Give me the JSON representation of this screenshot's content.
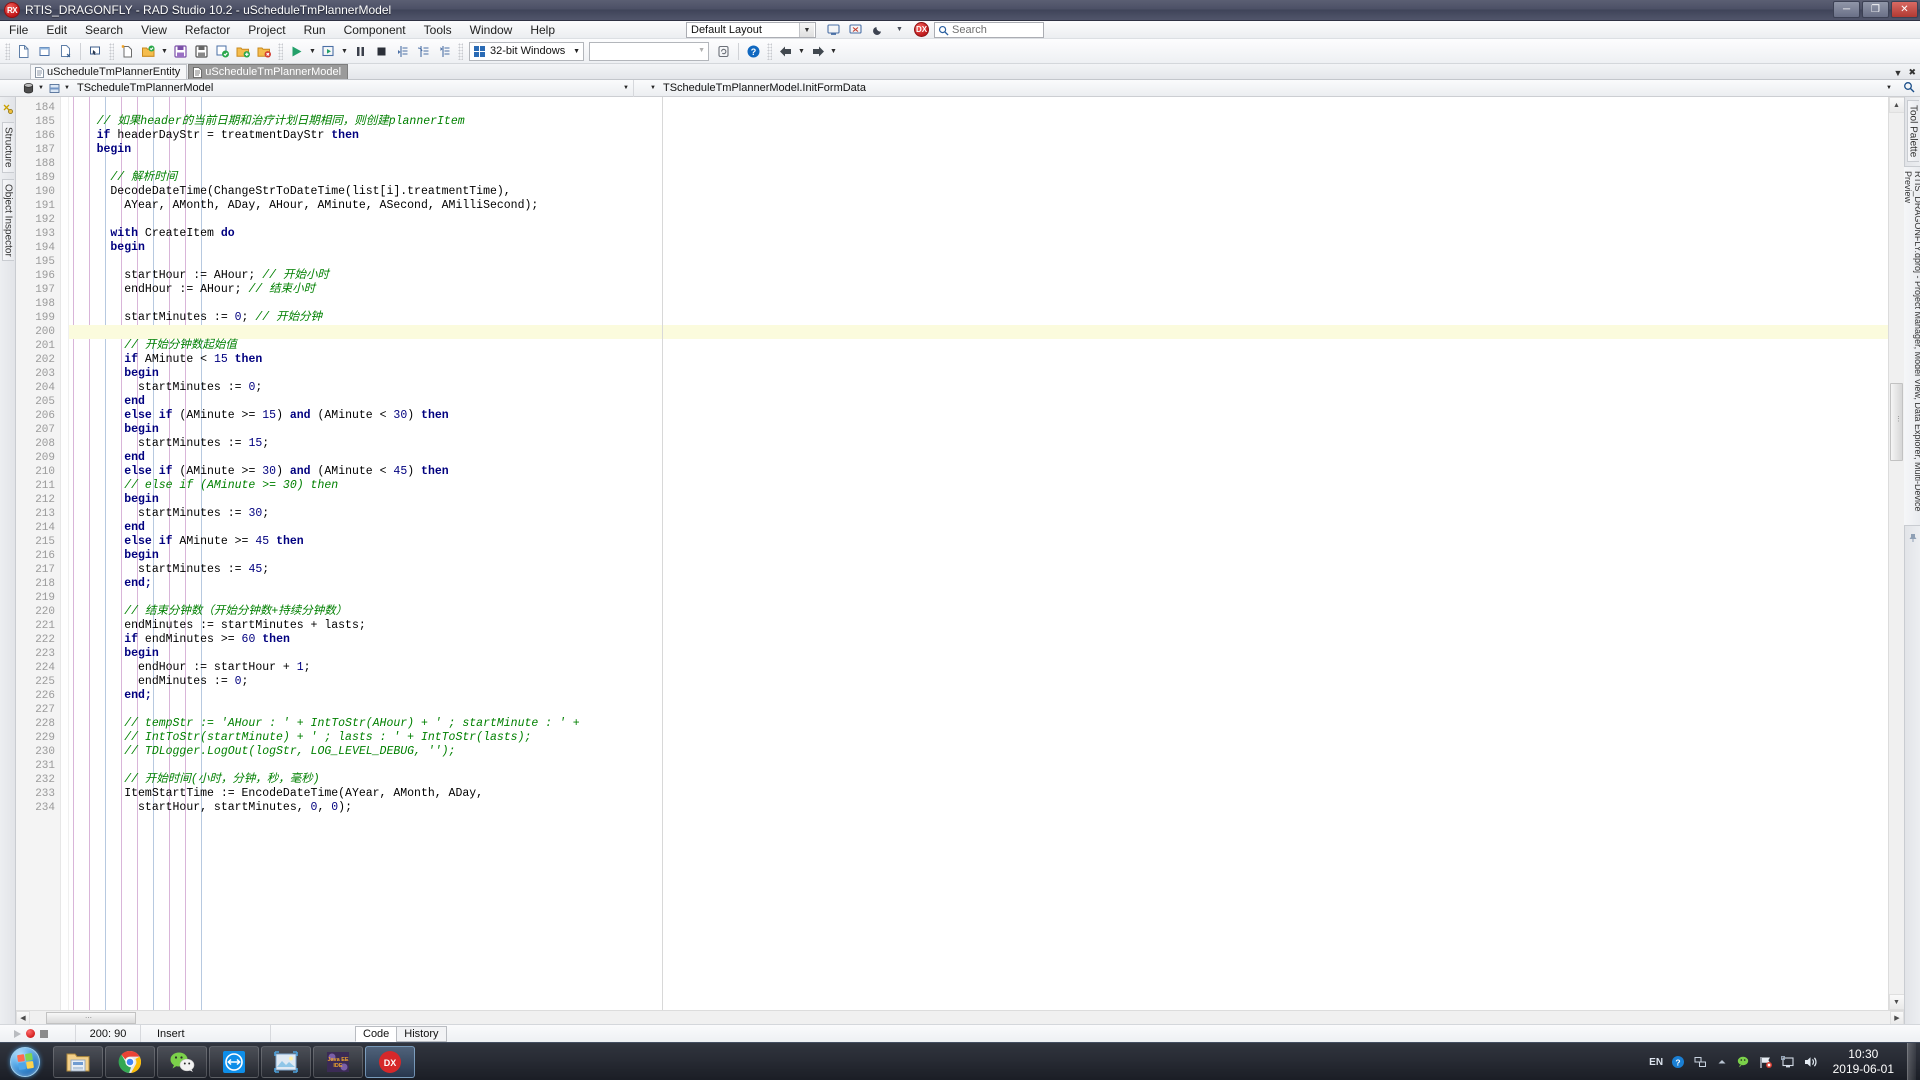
{
  "window": {
    "app_icon": "rad-studio-icon",
    "title": "RTIS_DRAGONFLY - RAD Studio 10.2 - uScheduleTmPlannerModel",
    "minimize": "─",
    "maximize": "❐",
    "close": "✕"
  },
  "menubar": {
    "items": [
      {
        "label": "File"
      },
      {
        "label": "Edit"
      },
      {
        "label": "Search"
      },
      {
        "label": "View"
      },
      {
        "label": "Refactor"
      },
      {
        "label": "Project"
      },
      {
        "label": "Run"
      },
      {
        "label": "Component"
      },
      {
        "label": "Tools"
      },
      {
        "label": "Window"
      },
      {
        "label": "Help"
      }
    ],
    "layout_combo": {
      "value": "Default Layout"
    },
    "search": {
      "placeholder": "Search",
      "value": ""
    }
  },
  "toolbar": {
    "platform_combo": {
      "value": "32-bit Windows"
    },
    "config_combo": {
      "value": ""
    },
    "buttons": [
      {
        "name": "new-file"
      },
      {
        "name": "new-form"
      },
      {
        "name": "new-other"
      },
      {
        "name": "view-form"
      },
      {
        "name": "open-file"
      },
      {
        "name": "open-project"
      },
      {
        "name": "save"
      },
      {
        "name": "save-as"
      },
      {
        "name": "save-all"
      },
      {
        "name": "add-to-project"
      },
      {
        "name": "remove-from-project"
      },
      {
        "name": "run"
      },
      {
        "name": "run-without-debugging"
      },
      {
        "name": "pause"
      },
      {
        "name": "stop"
      },
      {
        "name": "trace-into"
      },
      {
        "name": "step-over"
      },
      {
        "name": "run-to-cursor"
      },
      {
        "name": "refresh-config"
      },
      {
        "name": "help"
      },
      {
        "name": "back"
      },
      {
        "name": "forward"
      }
    ]
  },
  "file_tabs": [
    {
      "label": "uScheduleTmPlannerEntity",
      "active": false
    },
    {
      "label": "uScheduleTmPlannerModel",
      "active": true
    }
  ],
  "class_nav": {
    "left_value": "TScheduleTmPlannerModel",
    "right_value": "TScheduleTmPlannerModel.InitFormData"
  },
  "left_dock": {
    "tabs": [
      "Structure",
      "Object Inspector"
    ]
  },
  "right_dock": {
    "tabs": [
      "Tool Palette",
      "Project Manager, Model View, Data Explorer, Multi-Device Preview",
      "RTIS_DRAGONFLY.dproj - Project Manager, Model View, Data Explorer, Multi-Device Preview"
    ]
  },
  "editor": {
    "first_line": 184,
    "highlight_line": 200,
    "lines": [
      {
        "n": 184,
        "code": ""
      },
      {
        "n": 185,
        "code": "    // 如果header的当前日期和治疗计划日期相同，则创建plannerItem",
        "type": "comment"
      },
      {
        "n": 186,
        "code": "    if headerDayStr = treatmentDayStr then"
      },
      {
        "n": 187,
        "code": "    begin"
      },
      {
        "n": 188,
        "code": ""
      },
      {
        "n": 189,
        "code": "      // 解析时间",
        "type": "comment"
      },
      {
        "n": 190,
        "code": "      DecodeDateTime(ChangeStrToDateTime(list[i].treatmentTime),"
      },
      {
        "n": 191,
        "code": "        AYear, AMonth, ADay, AHour, AMinute, ASecond, AMilliSecond);"
      },
      {
        "n": 192,
        "code": ""
      },
      {
        "n": 193,
        "code": "      with CreateItem do"
      },
      {
        "n": 194,
        "code": "      begin"
      },
      {
        "n": 195,
        "code": ""
      },
      {
        "n": 196,
        "code": "        startHour := AHour; // 开始小时"
      },
      {
        "n": 197,
        "code": "        endHour := AHour; // 结束小时"
      },
      {
        "n": 198,
        "code": ""
      },
      {
        "n": 199,
        "code": "        startMinutes := 0; // 开始分钟"
      },
      {
        "n": 200,
        "code": "",
        "highlight": true
      },
      {
        "n": 201,
        "code": "        // 开始分钟数起始值",
        "type": "comment"
      },
      {
        "n": 202,
        "code": "        if AMinute < 15 then"
      },
      {
        "n": 203,
        "code": "        begin"
      },
      {
        "n": 204,
        "code": "          startMinutes := 0;"
      },
      {
        "n": 205,
        "code": "        end"
      },
      {
        "n": 206,
        "code": "        else if (AMinute >= 15) and (AMinute < 30) then"
      },
      {
        "n": 207,
        "code": "        begin"
      },
      {
        "n": 208,
        "code": "          startMinutes := 15;"
      },
      {
        "n": 209,
        "code": "        end"
      },
      {
        "n": 210,
        "code": "        else if (AMinute >= 30) and (AMinute < 45) then"
      },
      {
        "n": 211,
        "code": "        // else if (AMinute >= 30) then",
        "type": "comment"
      },
      {
        "n": 212,
        "code": "        begin"
      },
      {
        "n": 213,
        "code": "          startMinutes := 30;"
      },
      {
        "n": 214,
        "code": "        end"
      },
      {
        "n": 215,
        "code": "        else if AMinute >= 45 then"
      },
      {
        "n": 216,
        "code": "        begin"
      },
      {
        "n": 217,
        "code": "          startMinutes := 45;"
      },
      {
        "n": 218,
        "code": "        end;"
      },
      {
        "n": 219,
        "code": ""
      },
      {
        "n": 220,
        "code": "        // 结束分钟数（开始分钟数+持续分钟数）",
        "type": "comment"
      },
      {
        "n": 221,
        "code": "        endMinutes := startMinutes + lasts;"
      },
      {
        "n": 222,
        "code": "        if endMinutes >= 60 then"
      },
      {
        "n": 223,
        "code": "        begin"
      },
      {
        "n": 224,
        "code": "          endHour := startHour + 1;"
      },
      {
        "n": 225,
        "code": "          endMinutes := 0;"
      },
      {
        "n": 226,
        "code": "        end;"
      },
      {
        "n": 227,
        "code": ""
      },
      {
        "n": 228,
        "code": "        // tempStr := 'AHour : ' + IntToStr(AHour) + ' ; startMinute : ' +",
        "type": "comment"
      },
      {
        "n": 229,
        "code": "        // IntToStr(startMinute) + ' ; lasts : ' + IntToStr(lasts);",
        "type": "comment"
      },
      {
        "n": 230,
        "code": "        // TDLogger.LogOut(logStr, LOG_LEVEL_DEBUG, '');",
        "type": "comment"
      },
      {
        "n": 231,
        "code": ""
      },
      {
        "n": 232,
        "code": "        // 开始时间(小时，分钟，秒，毫秒)",
        "type": "comment"
      },
      {
        "n": 233,
        "code": "        ItemStartTime := EncodeDateTime(AYear, AMonth, ADay,"
      },
      {
        "n": 234,
        "code": "          startHour, startMinutes, 0, 0);"
      }
    ]
  },
  "statusbar": {
    "cursor_position": "200: 90",
    "insert_mode": "Insert",
    "view_tabs": [
      {
        "label": "Code",
        "active": true
      },
      {
        "label": "History",
        "active": false
      }
    ]
  },
  "taskbar": {
    "start_label": "Start",
    "apps": [
      {
        "name": "windows-explorer-icon"
      },
      {
        "name": "google-chrome-icon"
      },
      {
        "name": "wechat-icon"
      },
      {
        "name": "teamviewer-icon"
      },
      {
        "name": "photo-viewer-icon"
      },
      {
        "name": "java-ee-ide-icon"
      },
      {
        "name": "dx-app-icon"
      }
    ],
    "tray": {
      "language": "EN",
      "icons": [
        "help-icon",
        "network-icon",
        "show-hidden-icon",
        "wechat-tray-icon",
        "flag-icon",
        "monitor-icon",
        "volume-icon"
      ],
      "time": "10:30",
      "date": "2019-06-01"
    }
  },
  "colors": {
    "keyword": "#00007f",
    "comment": "#008000",
    "number": "#00007f",
    "highlight_line": "#fbfbdd",
    "title_bar": "#4c5066",
    "accent": "#1767b5"
  }
}
